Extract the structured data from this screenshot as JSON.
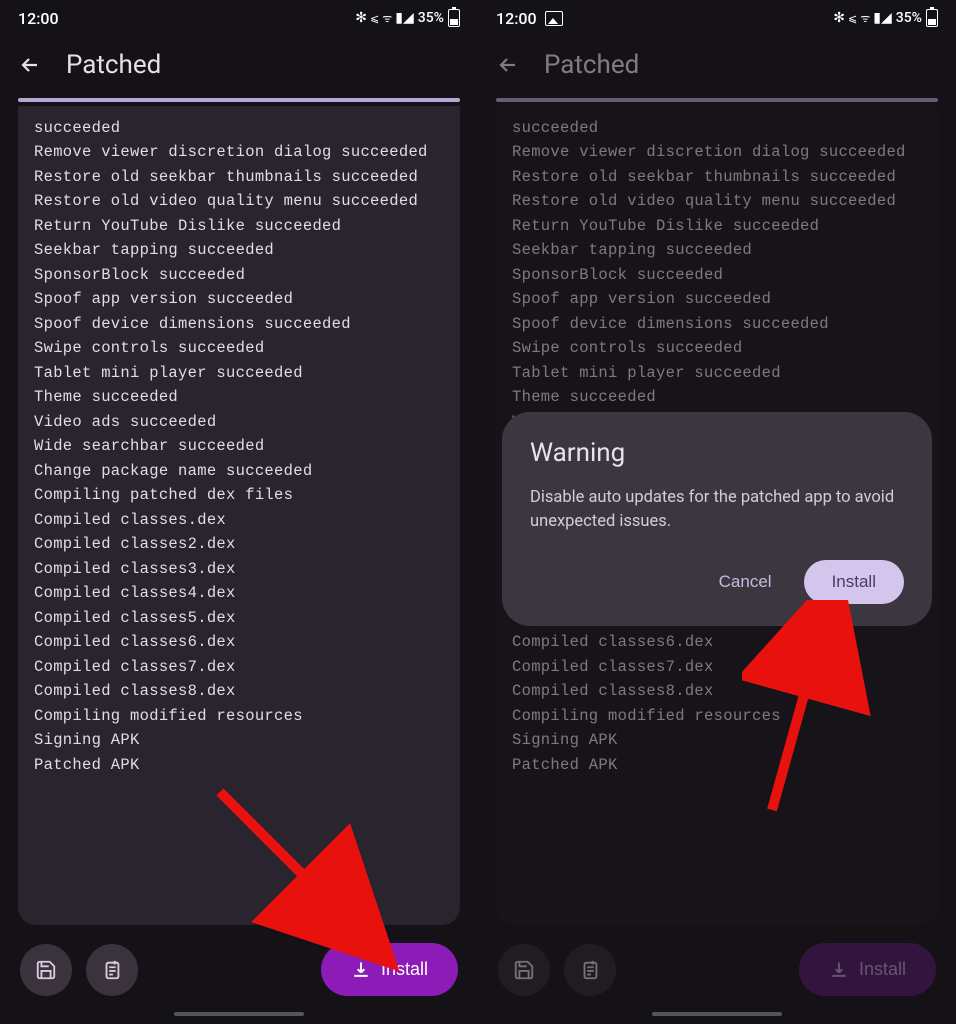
{
  "status": {
    "time": "12:00",
    "battery_pct": "35%",
    "icons": [
      "bluetooth",
      "vowifi",
      "volte",
      "signal",
      "battery"
    ]
  },
  "header": {
    "title": "Patched"
  },
  "log_lines": [
    "succeeded",
    "Remove viewer discretion dialog succeeded",
    "Restore old seekbar thumbnails succeeded",
    "Restore old video quality menu succeeded",
    "Return YouTube Dislike succeeded",
    "Seekbar tapping succeeded",
    "SponsorBlock succeeded",
    "Spoof app version succeeded",
    "Spoof device dimensions succeeded",
    "Swipe controls succeeded",
    "Tablet mini player succeeded",
    "Theme succeeded",
    "Video ads succeeded",
    "Wide searchbar succeeded",
    "Change package name succeeded",
    "Compiling patched dex files",
    "Compiled classes.dex",
    "Compiled classes2.dex",
    "Compiled classes3.dex",
    "Compiled classes4.dex",
    "Compiled classes5.dex",
    "Compiled classes6.dex",
    "Compiled classes7.dex",
    "Compiled classes8.dex",
    "Compiling modified resources",
    "Signing APK",
    "Patched APK"
  ],
  "buttons": {
    "install": "Install"
  },
  "dialog": {
    "title": "Warning",
    "message": "Disable auto updates for the patched app to avoid unexpected issues.",
    "cancel": "Cancel",
    "install": "Install"
  }
}
